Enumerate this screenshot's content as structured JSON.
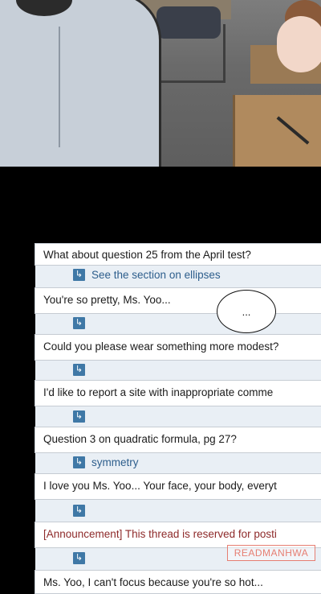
{
  "forum": {
    "rows": [
      "What about question 25 from the April test?",
      "You're so pretty, Ms. Yoo...",
      "Could you please wear something more modest?",
      "I'd like to report a site with inappropriate comme",
      "Question 3 on quadratic formula, pg 27?",
      "I love you Ms. Yoo... Your face, your body, everyt",
      "[Announcement] This thread is reserved for posti",
      "Ms. Yoo, I can't focus because you're so hot..."
    ],
    "replies": [
      "See the section on ellipses",
      "",
      "",
      "",
      "symmetry",
      "",
      ""
    ]
  },
  "bubble": {
    "text": "..."
  },
  "watermark": {
    "text": "READMANHWA"
  },
  "icons": {
    "reply": "reply-arrow-icon"
  },
  "colors": {
    "reply_text": "#2d5e8c",
    "reply_icon": "#3f78a6",
    "announcement": "#8e2a2a",
    "watermark": "#e67e72"
  }
}
